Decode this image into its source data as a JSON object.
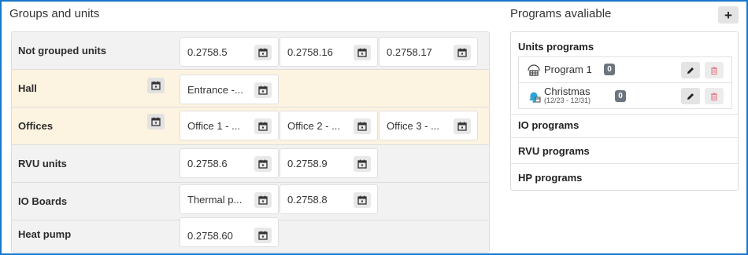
{
  "groups_section": {
    "title": "Groups and units",
    "rows": [
      {
        "name": "Not grouped units",
        "has_calendar": false,
        "highlight": false,
        "units": [
          "0.2758.5",
          "0.2758.16",
          "0.2758.17"
        ]
      },
      {
        "name": "Hall",
        "has_calendar": true,
        "highlight": true,
        "units": [
          "Entrance -..."
        ]
      },
      {
        "name": "Offices",
        "has_calendar": true,
        "highlight": true,
        "units": [
          "Office 1 - ...",
          "Office 2 - ...",
          "Office 3 - ..."
        ]
      },
      {
        "name": "RVU units",
        "has_calendar": false,
        "highlight": false,
        "units": [
          "0.2758.6",
          "0.2758.9"
        ]
      },
      {
        "name": "IO Boards",
        "has_calendar": false,
        "highlight": false,
        "units": [
          "Thermal p...",
          "0.2758.8"
        ]
      },
      {
        "name": "Heat pump",
        "has_calendar": false,
        "highlight": false,
        "units": [
          "0.2758.60"
        ]
      }
    ],
    "highlight_color": "#fdf3e1"
  },
  "programs_section": {
    "title": "Programs avaliable",
    "add_label": "+",
    "units_programs": {
      "title": "Units programs",
      "items": [
        {
          "name": "Program 1",
          "badge": "0",
          "icon": "building-icon"
        },
        {
          "name": "Christmas",
          "subtitle": "(12/23 - 12/31)",
          "badge": "0",
          "icon": "bell-calendar-icon"
        }
      ]
    },
    "other_sections": [
      {
        "title": "IO programs"
      },
      {
        "title": "RVU programs"
      },
      {
        "title": "HP programs"
      }
    ]
  },
  "colors": {
    "frame_border": "#1877c9",
    "delete_icon": "#e8838f",
    "bell_icon": "#2aa6d6"
  }
}
